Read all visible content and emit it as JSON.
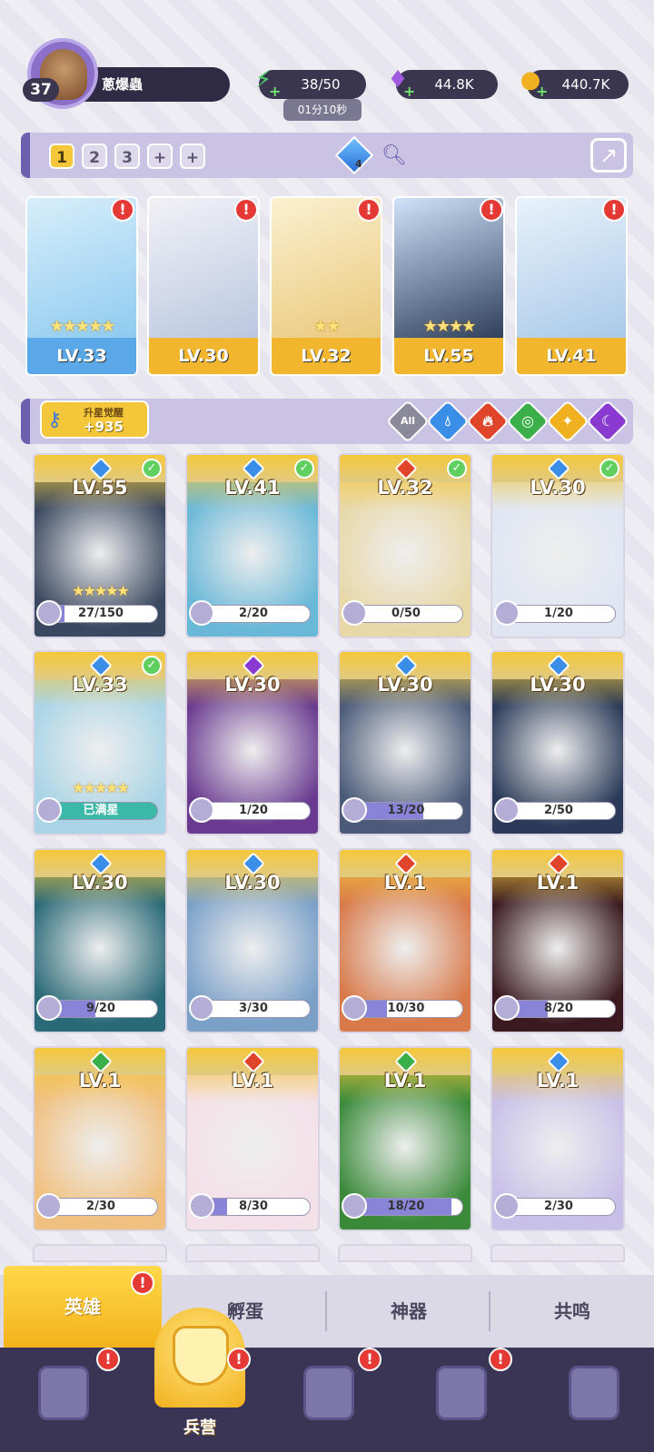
{
  "player": {
    "level": "37",
    "name": "蔥爆蟲"
  },
  "resources": {
    "energy": "38/50",
    "energy_timer": "01分10秒",
    "gems": "44.8K",
    "gold": "440.7K"
  },
  "team": {
    "slots": [
      "1",
      "2",
      "3",
      "+",
      "+"
    ],
    "crystal_count": "4"
  },
  "team_heroes": [
    {
      "level": "LV.33",
      "stars": "★★★★★",
      "element": "water",
      "color": "#5aa8e8"
    },
    {
      "level": "LV.30",
      "stars": "",
      "element": "water",
      "color": "#f1b62e"
    },
    {
      "level": "LV.32",
      "stars": "★★",
      "element": "fire",
      "color": "#f1b62e"
    },
    {
      "level": "LV.55",
      "stars": "★★★★",
      "element": "water",
      "color": "#f1b62e"
    },
    {
      "level": "LV.41",
      "stars": "",
      "element": "water",
      "color": "#f1b62e"
    }
  ],
  "star_up": {
    "label": "升星觉醒",
    "value": "+935"
  },
  "filters": [
    "All",
    "water",
    "fire",
    "wind",
    "light",
    "dark"
  ],
  "heroes": [
    {
      "level": "LV.55",
      "progress": "27/150",
      "pct": 0.18,
      "check": true,
      "stars": "★★★★★",
      "element": "water"
    },
    {
      "level": "LV.41",
      "progress": "2/20",
      "pct": 0.1,
      "check": true,
      "stars": "",
      "element": "water"
    },
    {
      "level": "LV.32",
      "progress": "0/50",
      "pct": 0,
      "check": true,
      "stars": "",
      "element": "fire"
    },
    {
      "level": "LV.30",
      "progress": "1/20",
      "pct": 0.05,
      "check": true,
      "stars": "",
      "element": "water"
    },
    {
      "level": "LV.33",
      "progress": "已满星",
      "pct": 1,
      "check": true,
      "stars": "★★★★★",
      "element": "water",
      "full": true
    },
    {
      "level": "LV.30",
      "progress": "1/20",
      "pct": 0.05,
      "check": false,
      "stars": "",
      "element": "dark"
    },
    {
      "level": "LV.30",
      "progress": "13/20",
      "pct": 0.65,
      "check": false,
      "stars": "",
      "element": "water"
    },
    {
      "level": "LV.30",
      "progress": "2/50",
      "pct": 0.04,
      "check": false,
      "stars": "",
      "element": "water"
    },
    {
      "level": "LV.30",
      "progress": "9/20",
      "pct": 0.45,
      "check": false,
      "stars": "",
      "element": "water"
    },
    {
      "level": "LV.30",
      "progress": "3/30",
      "pct": 0.1,
      "check": false,
      "stars": "",
      "element": "water"
    },
    {
      "level": "LV.1",
      "progress": "10/30",
      "pct": 0.33,
      "check": false,
      "stars": "",
      "element": "fire"
    },
    {
      "level": "LV.1",
      "progress": "8/20",
      "pct": 0.4,
      "check": false,
      "stars": "",
      "element": "fire"
    },
    {
      "level": "LV.1",
      "progress": "2/30",
      "pct": 0.07,
      "check": false,
      "stars": "",
      "element": "wind"
    },
    {
      "level": "LV.1",
      "progress": "8/30",
      "pct": 0.27,
      "check": false,
      "stars": "",
      "element": "fire"
    },
    {
      "level": "LV.1",
      "progress": "18/20",
      "pct": 0.9,
      "check": false,
      "stars": "",
      "element": "wind"
    },
    {
      "level": "LV.1",
      "progress": "2/30",
      "pct": 0.07,
      "check": false,
      "stars": "",
      "element": "water"
    }
  ],
  "tabs": [
    "英雄",
    "孵蛋",
    "神器",
    "共鸣"
  ],
  "nav": {
    "active_label": "兵营"
  },
  "colors": {
    "water": "#3a8ee8",
    "fire": "#e0442a",
    "wind": "#3bb04a",
    "light": "#f0b020",
    "dark": "#8a3ad0",
    "accent": "#f4c63a"
  }
}
